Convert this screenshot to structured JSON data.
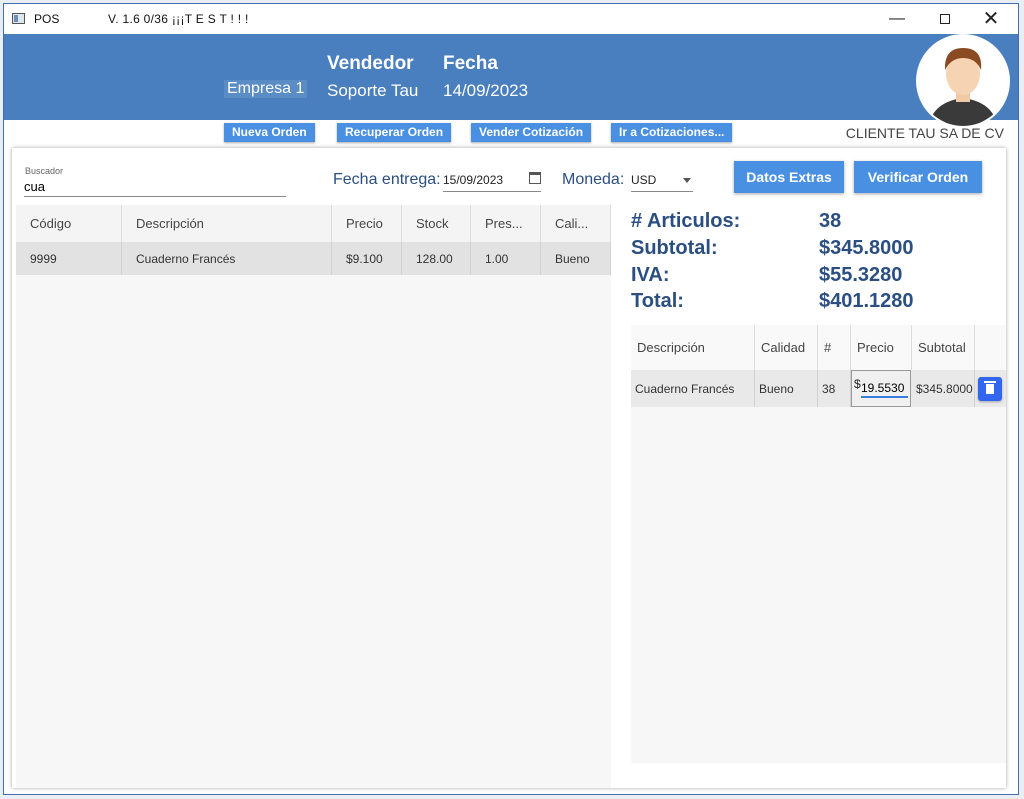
{
  "window": {
    "title": "POS",
    "version": "V. 1.6  0/36 ¡¡¡T E S T ! ! !",
    "controls": {
      "minimize": "—",
      "close": "✕"
    }
  },
  "header": {
    "company": "Empresa 1",
    "vendedor_label": "Vendedor",
    "vendedor_value": "Soporte Tau",
    "fecha_label": "Fecha",
    "fecha_value": "14/09/2023",
    "accent_color": "#4a7fbf"
  },
  "toolbar": {
    "nueva_orden": "Nueva Orden",
    "recuperar_orden": "Recuperar Orden",
    "vender_cotizacion": "Vender Cotización",
    "ir_cotizaciones": "Ir a Cotizaciones...",
    "client_name": "CLIENTE TAU SA DE CV"
  },
  "search": {
    "label": "Buscador",
    "value": "cua"
  },
  "order": {
    "fecha_entrega_label": "Fecha entrega:",
    "fecha_entrega_value": "15/09/2023",
    "moneda_label": "Moneda:",
    "moneda_value": "USD",
    "datos_extras": "Datos Extras",
    "verificar_orden": "Verificar Orden"
  },
  "products": {
    "columns": [
      "Código",
      "Descripción",
      "Precio",
      "Stock",
      "Pres...",
      "Cali..."
    ],
    "rows": [
      [
        "9999",
        "Cuaderno Francés",
        "$9.100",
        "128.00",
        "1.00",
        "Bueno"
      ]
    ]
  },
  "totals": {
    "articulos_label": "# Articulos:",
    "articulos_value": "38",
    "subtotal_label": "Subtotal:",
    "subtotal_value": "$345.8000",
    "iva_label": "IVA:",
    "iva_value": "$55.3280",
    "total_label": "Total:",
    "total_value": "$401.1280"
  },
  "cart": {
    "columns": [
      "Descripción",
      "Calidad",
      "#",
      "Precio",
      "Subtotal"
    ],
    "rows": [
      {
        "descripcion": "Cuaderno Francés",
        "calidad": "Bueno",
        "cantidad": "38",
        "currency": "$",
        "precio": "19.5530",
        "subtotal": "$345.8000"
      }
    ]
  }
}
